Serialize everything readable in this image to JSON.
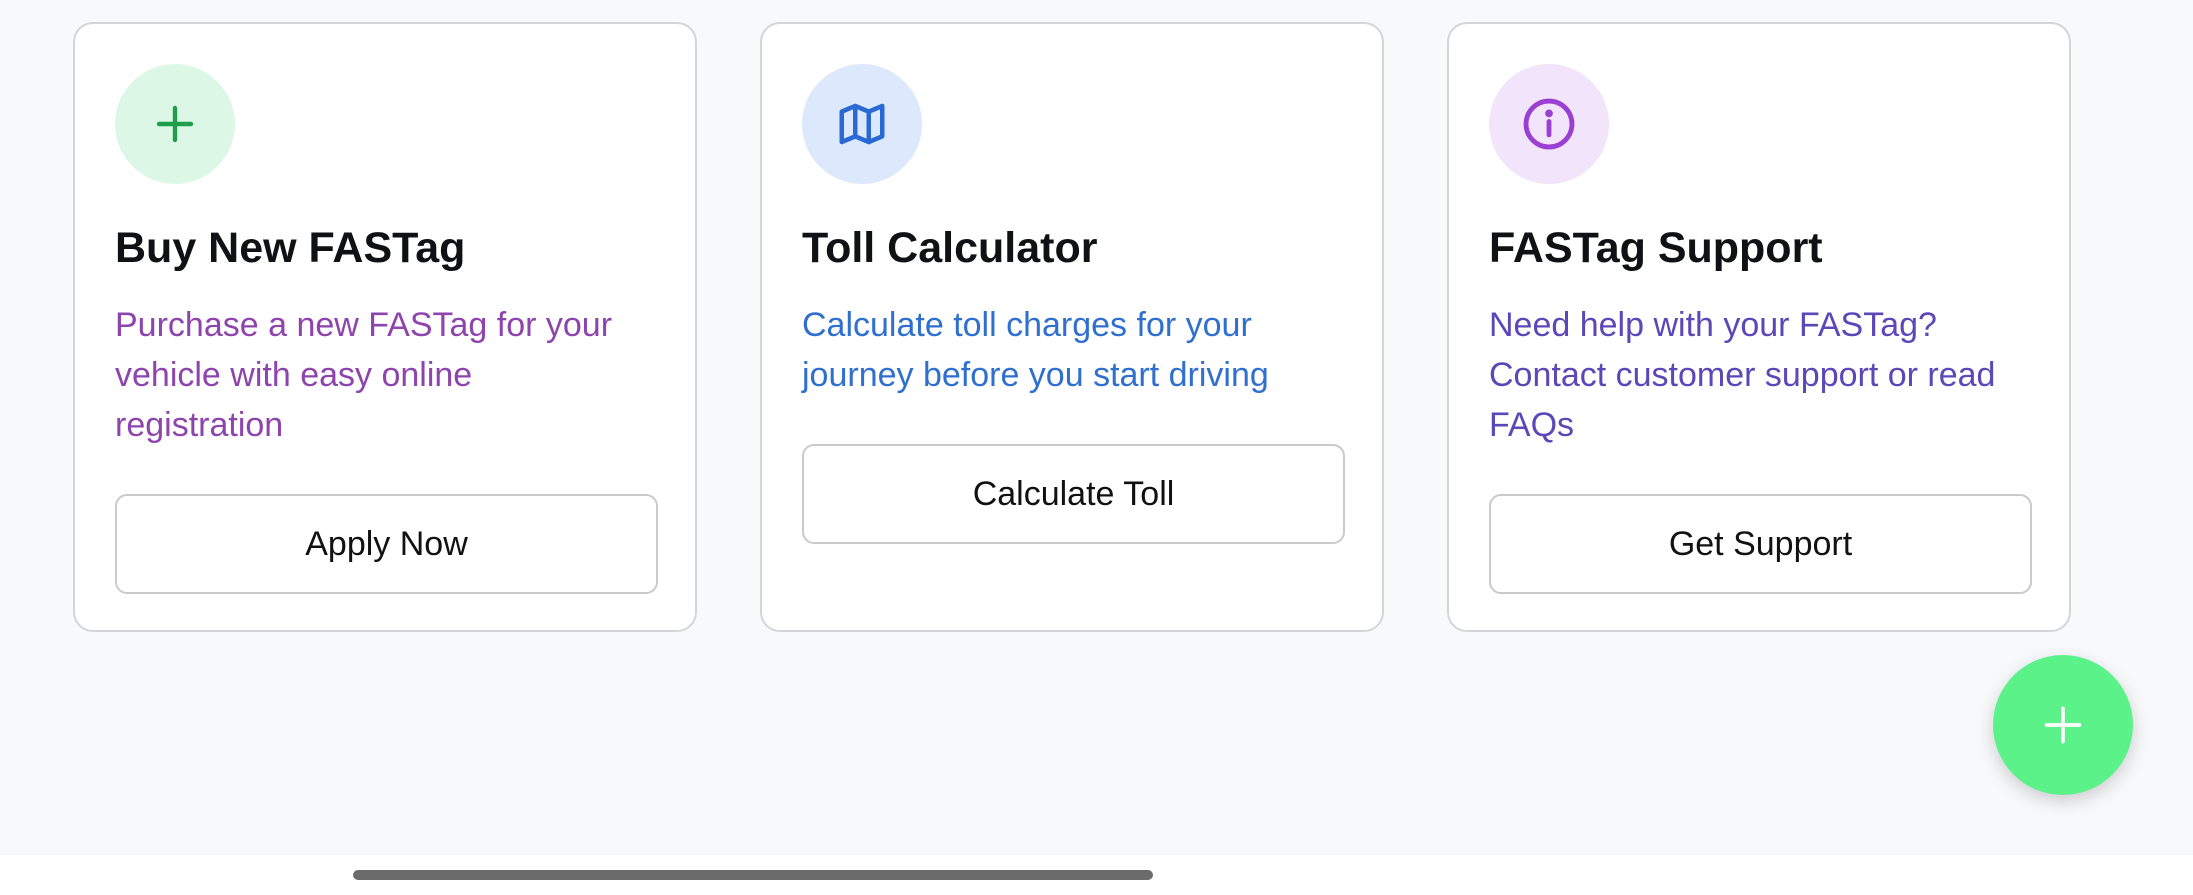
{
  "cards": [
    {
      "title": "Buy New FASTag",
      "description": "Purchase a new FASTag for your vehicle with easy online registration",
      "button_label": "Apply Now",
      "icon": "plus-icon",
      "icon_bg": "#dcf7e6",
      "icon_color": "#1e9e4a",
      "desc_color": "#8e44ad"
    },
    {
      "title": "Toll Calculator",
      "description": "Calculate toll charges for your journey before you start driving",
      "button_label": "Calculate Toll",
      "icon": "map-icon",
      "icon_bg": "#dce9fc",
      "icon_color": "#2a68d4",
      "desc_color": "#2f6fcf"
    },
    {
      "title": "FASTag Support",
      "description": "Need help with your FASTag? Contact customer support or read FAQs",
      "button_label": "Get Support",
      "icon": "info-icon",
      "icon_bg": "#f2e4fb",
      "icon_color": "#9a3fd2",
      "desc_color": "#5b47b8"
    }
  ],
  "fab": {
    "icon": "plus-icon",
    "color": "#5cf28a"
  }
}
